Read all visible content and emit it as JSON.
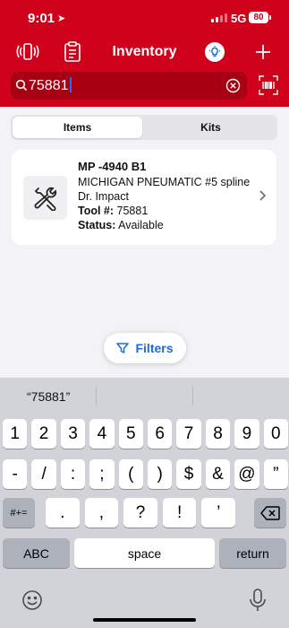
{
  "status_bar": {
    "time": "9:01",
    "network": "5G",
    "battery": "80"
  },
  "nav": {
    "title": "Inventory"
  },
  "search": {
    "value": "75881",
    "placeholder": ""
  },
  "tabs": [
    {
      "label": "Items",
      "active": true
    },
    {
      "label": "Kits",
      "active": false
    }
  ],
  "results": [
    {
      "title": "MP -4940 B1",
      "description": "MICHIGAN PNEUMATIC  #5 spline Dr. Impact",
      "tool_label": "Tool #:",
      "tool_number": "75881",
      "status_label": "Status:",
      "status": "Available"
    }
  ],
  "filters_label": "Filters",
  "keyboard": {
    "suggestion": "“75881”",
    "row1": [
      "1",
      "2",
      "3",
      "4",
      "5",
      "6",
      "7",
      "8",
      "9",
      "0"
    ],
    "row2": [
      "-",
      "/",
      ":",
      ";",
      "(",
      ")",
      "$",
      "&",
      "@",
      "”"
    ],
    "row3_toggle": "#+=",
    "row3": [
      ".",
      ",",
      "?",
      "!",
      "’"
    ],
    "abc": "ABC",
    "space": "space",
    "return": "return"
  },
  "colors": {
    "brand": "#d0021b",
    "link": "#1e6bd6"
  }
}
